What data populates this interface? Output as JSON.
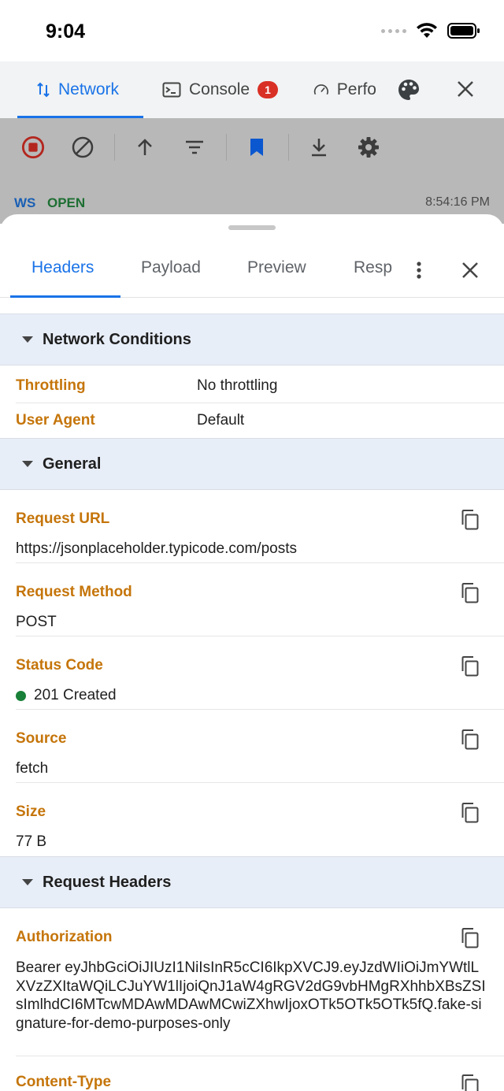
{
  "status_bar": {
    "time": "9:04"
  },
  "top_tabs": {
    "network": "Network",
    "console": "Console",
    "console_badge": "1",
    "performance": "Perfo"
  },
  "request": {
    "protocol": "WS",
    "state": "OPEN",
    "time": "8:54:16 PM"
  },
  "sub_tabs": {
    "headers": "Headers",
    "payload": "Payload",
    "preview": "Preview",
    "response": "Resp"
  },
  "sections": {
    "network_conditions": {
      "title": "Network Conditions",
      "rows": [
        {
          "key": "Throttling",
          "value": "No throttling"
        },
        {
          "key": "User Agent",
          "value": "Default"
        }
      ]
    },
    "general": {
      "title": "General",
      "fields": [
        {
          "key": "Request URL",
          "value": "https://jsonplaceholder.typicode.com/posts"
        },
        {
          "key": "Request Method",
          "value": "POST"
        },
        {
          "key": "Status Code",
          "value": "201 Created"
        },
        {
          "key": "Source",
          "value": "fetch"
        },
        {
          "key": "Size",
          "value": "77 B"
        }
      ]
    },
    "request_headers": {
      "title": "Request Headers",
      "authorization_key": "Authorization",
      "authorization_value": "Bearer eyJhbGciOiJIUzI1NiIsInR5cCI6IkpXVCJ9.eyJzdWIiOiJmYWtlLXVzZXItaWQiLCJuYW1lIjoiQnJ1aW4gRGV2dG9vbHMgRXhhbXBsZSIsImlhdCI6MTcwMDAwMDAwMCwiZXhwIjoxOTk5OTk5OTk5fQ.fake-signature-for-demo-purposes-only",
      "content_type_key": "Content-Type"
    }
  },
  "colors": {
    "accent": "#1a73e8",
    "key": "#c5750a",
    "status_ok": "#188038",
    "badge": "#d93025"
  }
}
